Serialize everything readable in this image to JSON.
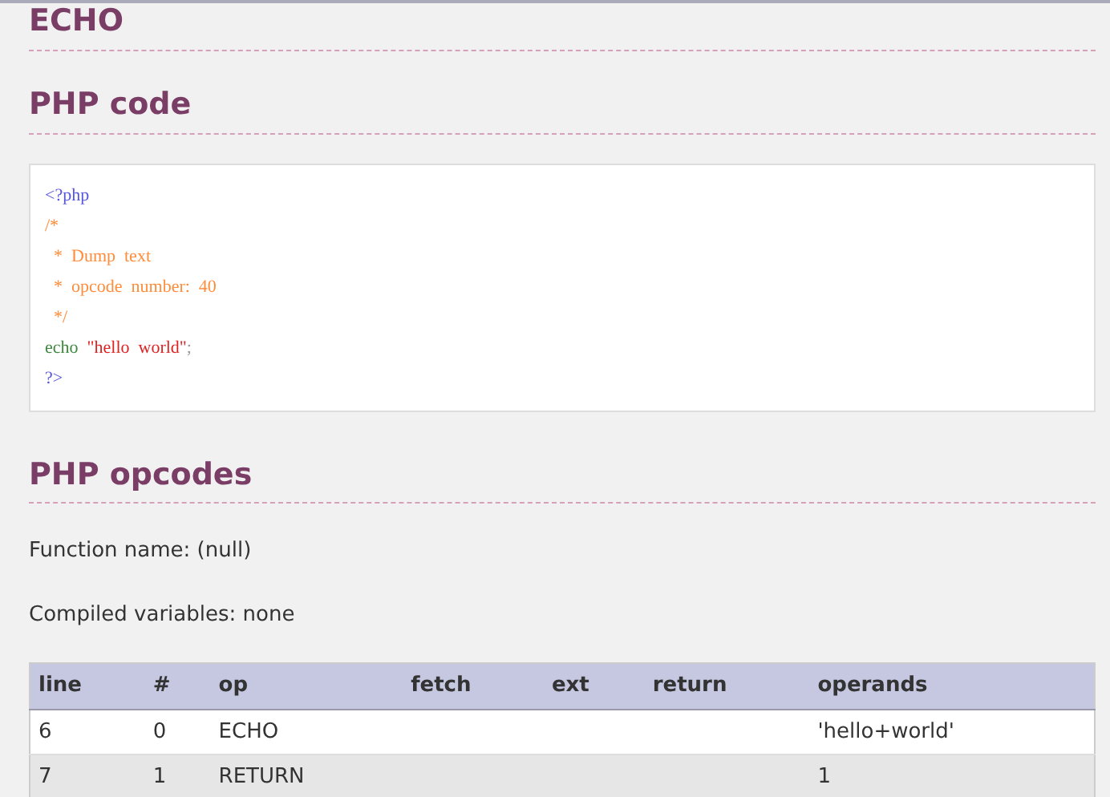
{
  "title": "ECHO",
  "code_section": {
    "heading": "PHP code",
    "lines": [
      [
        {
          "kind": "tag",
          "text": "<?php"
        }
      ],
      [
        {
          "kind": "comment",
          "text": "/*"
        }
      ],
      [
        {
          "kind": "comment",
          "text": "  *  Dump  text"
        }
      ],
      [
        {
          "kind": "comment",
          "text": "  *  opcode  number:  40"
        }
      ],
      [
        {
          "kind": "comment",
          "text": "  */"
        }
      ],
      [
        {
          "kind": "keyword",
          "text": "echo  "
        },
        {
          "kind": "string",
          "text": "\"hello  world\""
        },
        {
          "kind": "punct",
          "text": ";"
        }
      ],
      [
        {
          "kind": "tag",
          "text": "?>"
        }
      ]
    ]
  },
  "opcodes_section": {
    "heading": "PHP opcodes",
    "function_name": "Function name: (null)",
    "compiled_variables": "Compiled variables: none",
    "table": {
      "columns": [
        "line",
        "#",
        "op",
        "fetch",
        "ext",
        "return",
        "operands"
      ],
      "rows": [
        [
          "6",
          "0",
          "ECHO",
          "",
          "",
          "",
          "'hello+world'"
        ],
        [
          "7",
          "1",
          "RETURN",
          "",
          "",
          "",
          "1"
        ]
      ]
    }
  }
}
